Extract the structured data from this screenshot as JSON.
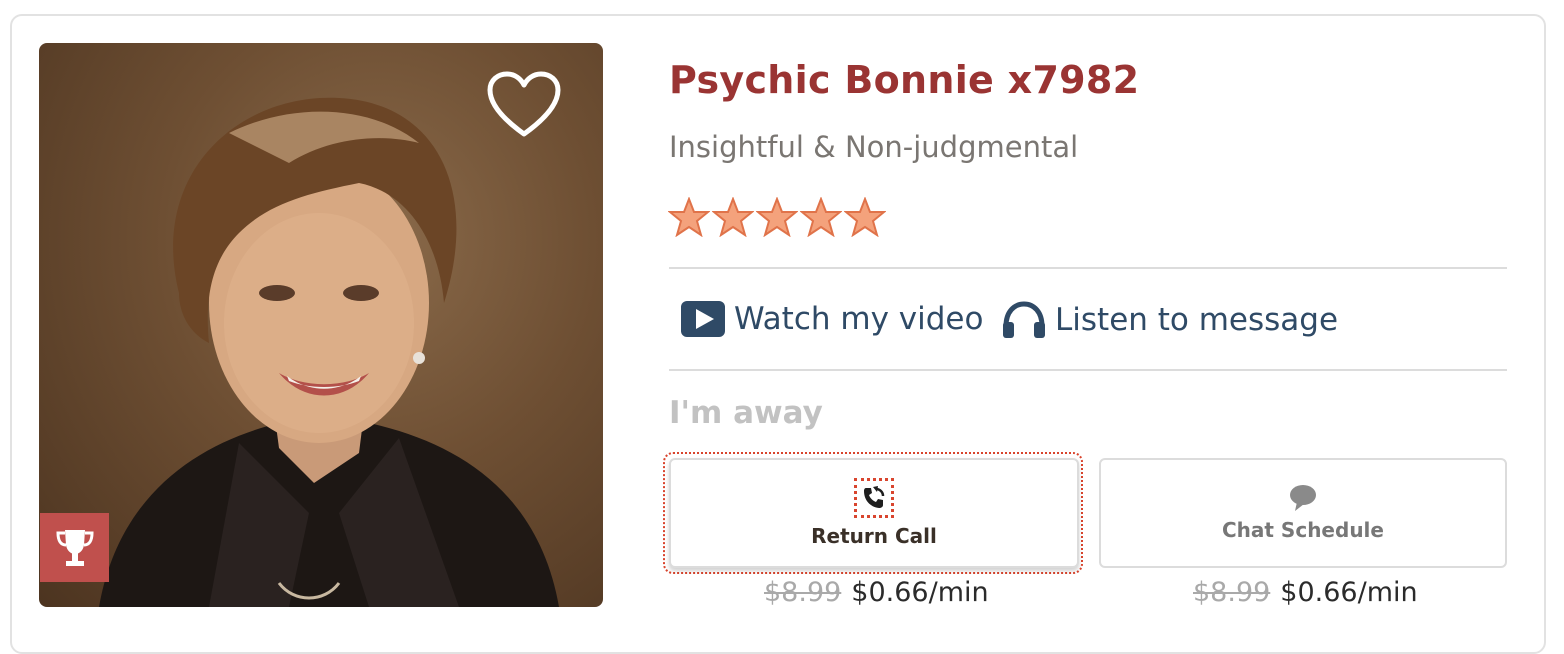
{
  "profile": {
    "name": "Psychic Bonnie x7982",
    "tagline": "Insightful & Non-judgmental",
    "rating_stars": 5,
    "photo_icon": "portrait-photo",
    "favorite_icon": "heart-outline-icon",
    "badge_icon": "trophy-icon"
  },
  "media": {
    "video_label": "Watch my video",
    "message_label": "Listen to message"
  },
  "status_text": "I'm away",
  "actions": {
    "return_call": {
      "label": "Return Call",
      "old_price": "$8.99",
      "price": "$0.66/min"
    },
    "chat_schedule": {
      "label": "Chat Schedule",
      "old_price": "$8.99",
      "price": "$0.66/min"
    }
  },
  "colors": {
    "name": "#9a3433",
    "star": "#f4a27c",
    "link": "#2f4a66",
    "badge": "#c0504d",
    "focus": "#d9452e"
  }
}
